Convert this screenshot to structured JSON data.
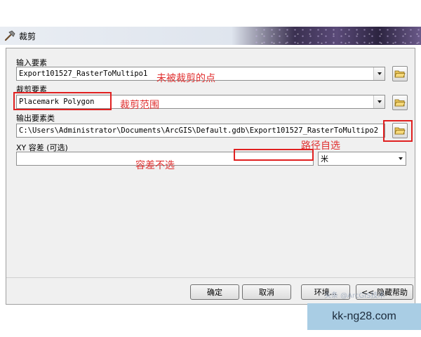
{
  "window": {
    "title": "裁剪",
    "icon": "hammer-icon"
  },
  "form": {
    "input_features": {
      "label": "输入要素",
      "value": "Export101527_RasterToMultipo1"
    },
    "clip_features": {
      "label": "裁剪要素",
      "value": "Placemark Polygon"
    },
    "output_feature_class": {
      "label": "输出要素类",
      "value": "C:\\Users\\Administrator\\Documents\\ArcGIS\\Default.gdb\\Export101527_RasterToMultipo2"
    },
    "xy_tolerance": {
      "label": "XY 容差 (可选)",
      "value": "",
      "unit": "米"
    }
  },
  "annotations": {
    "input": "未被裁剪的点",
    "clip": "裁剪范围",
    "output_path": "路径自选",
    "tolerance": "容差不选"
  },
  "buttons": {
    "ok": "确定",
    "cancel": "取消",
    "environments": "环境...",
    "hide_help": "<< 隐藏帮助"
  },
  "watermark": {
    "url": "kk-ng28.com",
    "faint": "头条 @ArcGIS技术"
  },
  "colors": {
    "annotation": "#e02020",
    "watermark_bg": "#a9cde4"
  }
}
